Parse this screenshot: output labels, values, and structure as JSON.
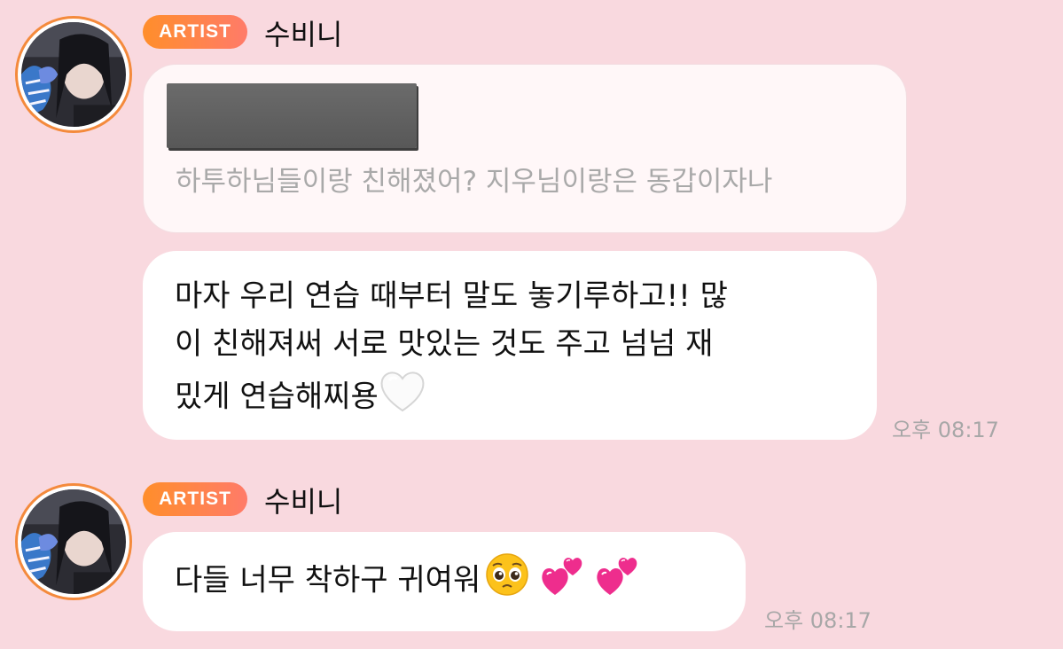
{
  "colors": {
    "background": "#f9d9df",
    "badge_gradient_start": "#ff8e2b",
    "badge_gradient_end": "#ff7b69",
    "avatar_ring": "#f48a3c",
    "bubble": "#ffffff",
    "quote_text": "#a9a9a9",
    "time_text": "#a7a7a7"
  },
  "messages": [
    {
      "badge": "ARTIST",
      "sender": "수비니",
      "avatar_icon": "profile-photo",
      "reply": {
        "redacted_icon": "redacted-block",
        "quoted_text": "하투하님들이랑 친해졌어? 지우님이랑은 동갑이자나"
      },
      "lines": [
        "마자 우리 연습 때부터 말도 놓기루하고!! 많",
        "이 친해져써 서로 맛있는 것도 주고 넘넘 재",
        "밌게 연습해찌용"
      ],
      "emoji": "white-heart-icon",
      "time": "오후 08:17"
    },
    {
      "badge": "ARTIST",
      "sender": "수비니",
      "avatar_icon": "profile-photo",
      "text": "다들 너무 착하구 귀여워",
      "emojis": [
        "pleading-face-icon",
        "two-hearts-icon",
        "two-hearts-icon"
      ],
      "time": "오후 08:17"
    }
  ]
}
